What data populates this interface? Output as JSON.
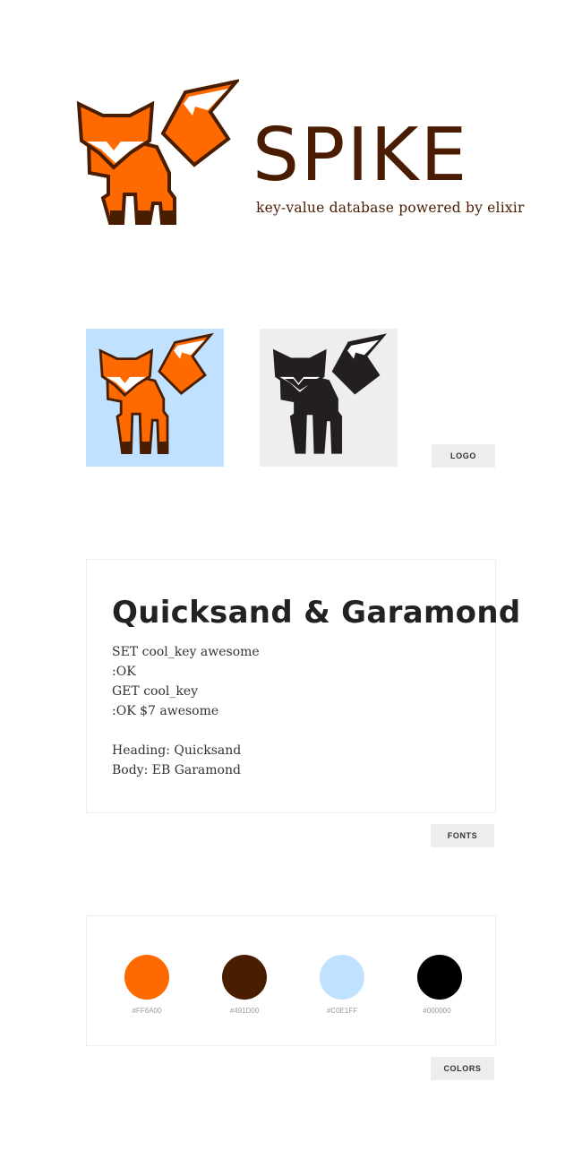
{
  "brand": {
    "title": "SPIKE",
    "tagline": "key-value database powered by elixir"
  },
  "logo_section": {
    "tiles": [
      {
        "background": "#C0E1FF",
        "fox": "color"
      },
      {
        "background": "#EEEEEE",
        "fox": "mono"
      }
    ],
    "tag": "LOGO"
  },
  "fonts_section": {
    "heading": "Quicksand & Garamond",
    "code_lines": [
      "SET cool_key awesome",
      ":OK",
      "GET cool_key",
      ":OK $7 awesome"
    ],
    "heading_font_label": "Heading: Quicksand",
    "body_font_label": "Body: EB Garamond",
    "tag": "FONTS"
  },
  "colors_section": {
    "swatches": [
      {
        "hex": "#FF6A00",
        "color": "#FF6A00"
      },
      {
        "hex": "#491D00",
        "color": "#491D00"
      },
      {
        "hex": "#C0E1FF",
        "color": "#C0E1FF"
      },
      {
        "hex": "#000000",
        "color": "#000000"
      }
    ],
    "tag": "COLORS"
  },
  "palette": {
    "orange": "#FF6A00",
    "brown": "#491D00",
    "light_blue": "#C0E1FF",
    "black": "#000000",
    "fox_mono": "#231f20"
  }
}
